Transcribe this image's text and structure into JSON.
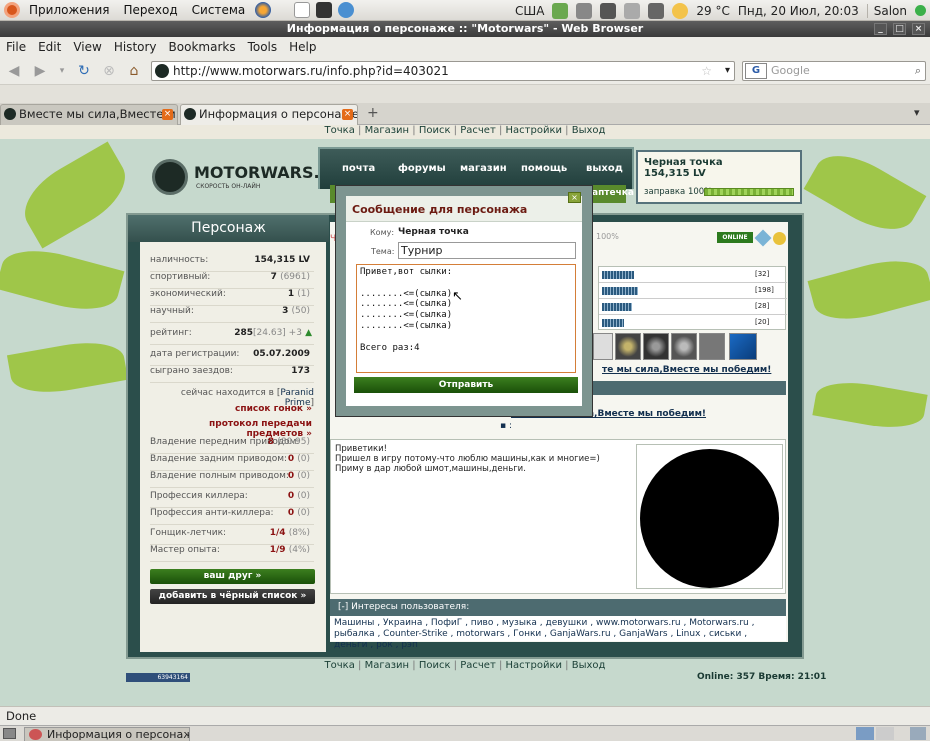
{
  "panel": {
    "menus": [
      "Приложения",
      "Переход",
      "Система"
    ],
    "keyboard": "США",
    "weather": "29 °C",
    "clock": "Пнд, 20 Июл, 20:03",
    "user": "Salon"
  },
  "window": {
    "title": "Информация о персонаже :: \"Motorwars\" - Web Browser"
  },
  "menubar": [
    "File",
    "Edit",
    "View",
    "History",
    "Bookmarks",
    "Tools",
    "Help"
  ],
  "nav": {
    "url": "http://www.motorwars.ru/info.php?id=403021",
    "search_engine": "G",
    "search_placeholder": "Google"
  },
  "tabs": [
    {
      "label": "Вместе мы сила,Вместе м..."
    },
    {
      "label": "Информация о персонаже..."
    }
  ],
  "toplinks": [
    "Точка",
    "Магазин",
    "Поиск",
    "Расчет",
    "Настройки",
    "Выход"
  ],
  "site": {
    "logo_title": "MOTORWARS.RU",
    "logo_sub": "СКОРОСТЬ ОН-ЛАЙН",
    "nav_items": [
      "почта",
      "форумы",
      "магазин",
      "помощь",
      "выход"
    ],
    "nav_green_label": "аптечка"
  },
  "fuel": {
    "name": "Черная точка",
    "balance": "154,315 LV",
    "label": "заправка 100%",
    "percent": 100
  },
  "profile": {
    "heading": "Персонаж",
    "rows": [
      {
        "label": "наличность:",
        "value": "154,315 LV",
        "extra": ""
      },
      {
        "label": "спортивный:",
        "value": "7",
        "extra": "(6961)"
      },
      {
        "label": "экономический:",
        "value": "1",
        "extra": "(1)"
      },
      {
        "label": "научный:",
        "value": "3",
        "extra": "(50)"
      },
      {
        "label": "рейтинг:",
        "value": "285",
        "extra": "[24.63] +3"
      },
      {
        "label": "дата регистрации:",
        "value": "05.07.2009",
        "extra": ""
      },
      {
        "label": "сыграно заездов:",
        "value": "173",
        "extra": ""
      }
    ],
    "location_prefix": "сейчас находится в [",
    "location": "Paranid Prime",
    "location_suffix": "]",
    "race_list": "список гонок »",
    "transfer_log": "протокол передачи предметов »",
    "skills": [
      {
        "label": "Владение передним приводом:",
        "value": "8",
        "extra": "(80.95)"
      },
      {
        "label": "Владение задним приводом:",
        "value": "0",
        "extra": "(0)"
      },
      {
        "label": "Владение полным приводом:",
        "value": "0",
        "extra": "(0)"
      },
      {
        "label": "Профессия киллера:",
        "value": "0",
        "extra": "(0)"
      },
      {
        "label": "Профессия анти-киллера:",
        "value": "0",
        "extra": "(0)"
      },
      {
        "label": "Гонщик-летчик:",
        "value": "1/4",
        "extra": "(8%)"
      },
      {
        "label": "Мастер опыта:",
        "value": "1/9",
        "extra": "(4%)"
      }
    ],
    "friend_btn": "ваш друг »",
    "blacklist_btn": "добавить в чёрный список »"
  },
  "right": {
    "online_badge": "ONLINE",
    "fuel_pct": "100%",
    "bars": [
      {
        "value": "[32]",
        "fill": 0.32
      },
      {
        "value": "[198]",
        "fill": 0.36
      },
      {
        "value": "[28]",
        "fill": 0.3
      },
      {
        "value": "[20]",
        "fill": 0.22
      }
    ],
    "clan_link": "те мы сила,Вместе мы победим!",
    "clan_link2": "Вместе мы сила,Вместе мы победим!",
    "bullet_text": ":"
  },
  "about": {
    "lines": [
      "Приветики!",
      "Пришел в игру потому-что люблю машины,как и многие=)",
      "Приму в дар любой шмот,машины,деньги."
    ]
  },
  "interests": {
    "heading": "[-]  Интересы пользователя:",
    "text": "Машины , Украина , ПофиГ , пиво , музыка , девушки , www.motorwars.ru , Motorwars.ru , рыбалка , Counter-Strike , motorwars , Гонки , GanjaWars.ru , GanjaWars , Linux , сиськи , деньги , рок , рэп"
  },
  "footer": {
    "online": "Online: 357",
    "time": "Время: 21:01",
    "counter": "63943164"
  },
  "modal": {
    "title": "Сообщение для персонажа",
    "to_label": "Кому:",
    "to_value": "Черная точка",
    "subject_label": "Тема:",
    "subject_value": "Турнир",
    "body": "Привет,вот сылки:\n\n........<=(сылка)\n........<=(сылка)\n........<=(сылка)\n........<=(сылка)\n\nВсего раз:4",
    "send": "Отправить"
  },
  "status": "Done",
  "taskbar": {
    "item": "Информация о персонаж..."
  },
  "colors": {
    "panel_bg": "#2b4e4b",
    "accent_green": "#1a5009",
    "link_red": "#8b1212"
  }
}
